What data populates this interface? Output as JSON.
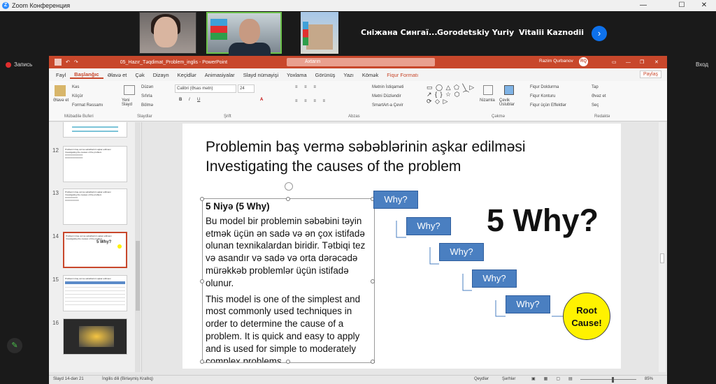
{
  "zoom": {
    "title": "Zoom Конференция",
    "controls": [
      "—",
      "☐",
      "✕"
    ],
    "participants": [
      "Сніжана Сингаї...",
      "Gorodetskiy Yuriy",
      "Vitalii Kaznodii"
    ],
    "record_label": "Запись",
    "login_label": "Вход"
  },
  "ppt": {
    "file_title": "05_Hazır_Təqdimat_Problem_inglis  -  PowerPoint",
    "search_placeholder": "Axtarın",
    "user_name": "Razim Qurbanov",
    "user_initials": "RQ",
    "tabs": [
      "Fayl",
      "Başlanğıc",
      "Əlavə et",
      "Çək",
      "Dizayn",
      "Keçidlər",
      "Animasiyalar",
      "Slayd nümayişi",
      "Yoxlama",
      "Görünüş",
      "Yazı",
      "Kömək",
      "Fiqur Formatı"
    ],
    "share_label": "Paylaş",
    "ribbon_groups": [
      "Mübadilə Buferi",
      "Slaydlar",
      "Şrift",
      "Abzas",
      "Çəkmə",
      "Redaktə"
    ],
    "ribbon": {
      "paste": "Əlavə et",
      "cut": "Kəs",
      "copy": "Köçür",
      "format_painter": "Format Rəssamı",
      "new_slide": "Yeni Slayd",
      "layout": "Düzən",
      "reset": "Sıfırla",
      "section": "Bölmə",
      "font": "Calibri (Əsas mətn)",
      "font_size": "24",
      "text_direction": "Mətnin İstiqaməti",
      "align_text": "Mətni Düzləndir",
      "smartart": "SmartArt-a Çevir",
      "arrange": "Nizamla",
      "quick_styles": "Çevik Üslublar",
      "shape_fill": "Fiqur Doldurma",
      "shape_outline": "Fiqur Konturu",
      "shape_effects": "Fiqur üçün Effektlər",
      "find": "Tap",
      "replace": "Əvəz et",
      "select": "Seç"
    },
    "thumb_numbers": [
      "12",
      "13",
      "14",
      "15",
      "16"
    ],
    "status": {
      "slide": "Slayd 14-dən 21",
      "lang": "İngilis dili (Birləşmiş Krallıq)",
      "notes": "Qeydlər",
      "comments": "Şərhlər",
      "zoom": "85%"
    }
  },
  "slide": {
    "title_az": "Problemin baş vermə səbəblərinin aşkar edilməsi",
    "title_en": "Investigating the causes of the problem",
    "heading": "5 Niyə (5 Why)",
    "para_az": "Bu model bir problemin səbəbini təyin etmək üçün ən sadə və ən çox istifadə olunan texnikalardan biridir. Tətbiqi tez və asandır və sadə və orta dərəcədə mürəkkəb problemlər üçün istifadə olunur.",
    "para_en": "This model is one of the simplest and most commonly used techniques in order to determine the cause of a problem. It is quick and easy to apply and is used for simple to moderately complex problems.",
    "why_label": "Why?",
    "big_label": "5 Why?",
    "root_label": "Root Cause!"
  },
  "colors": {
    "accent": "#c8472b",
    "why_box": "#4a7fc1",
    "root": "#fff200"
  }
}
